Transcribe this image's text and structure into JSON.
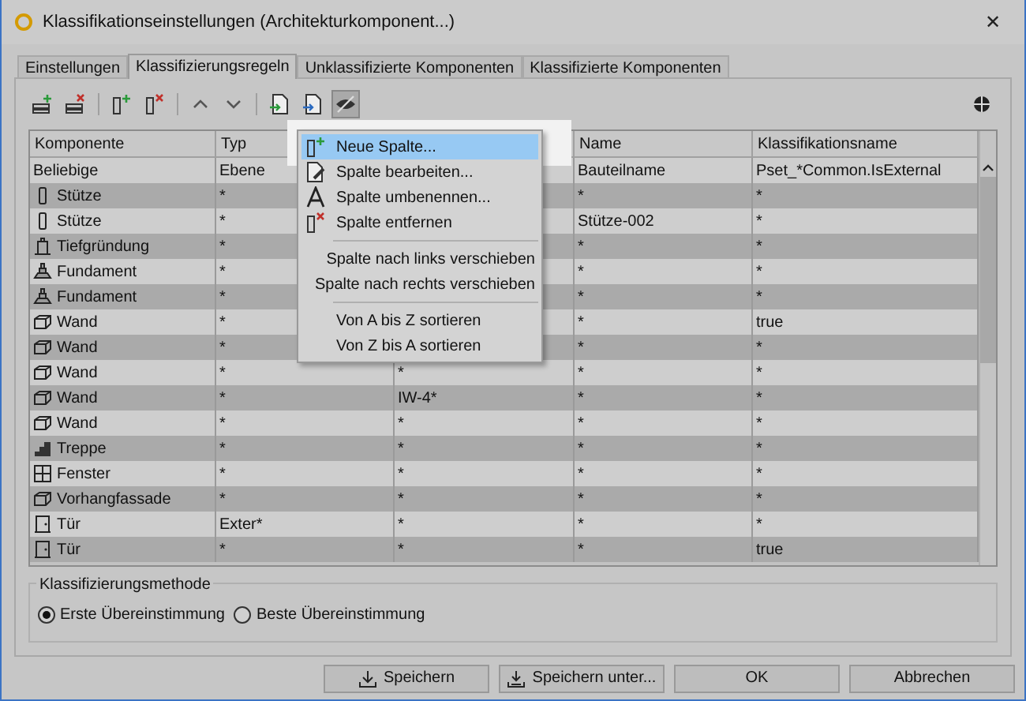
{
  "window": {
    "title": "Klassifikationseinstellungen (Architekturkomponent...)",
    "close": "✕"
  },
  "tabs": [
    {
      "label": "Einstellungen",
      "selected": false
    },
    {
      "label": "Klassifizierungsregeln",
      "selected": true
    },
    {
      "label": "Unklassifizierte Komponenten",
      "selected": false
    },
    {
      "label": "Klassifizierte Komponenten",
      "selected": false
    }
  ],
  "toolbar": [
    {
      "kind": "add-row"
    },
    {
      "kind": "remove-row"
    },
    {
      "kind": "sep"
    },
    {
      "kind": "add-column"
    },
    {
      "kind": "remove-column"
    },
    {
      "kind": "sep"
    },
    {
      "kind": "up"
    },
    {
      "kind": "down"
    },
    {
      "kind": "sep"
    },
    {
      "kind": "import"
    },
    {
      "kind": "export"
    },
    {
      "kind": "hide",
      "pressed": true
    }
  ],
  "table": {
    "columns": [
      {
        "label": "Komponente"
      },
      {
        "label": "Typ"
      },
      {},
      {
        "label": "Name"
      },
      {
        "label": "Klassifikationsname"
      }
    ],
    "rows": [
      {
        "cells": [
          "Beliebige",
          "Ebene",
          null,
          "Bauteilname",
          "Pset_*Common.IsExternal"
        ]
      },
      {
        "kind": "column",
        "cells": [
          "Stütze",
          "*",
          null,
          "*",
          "*"
        ]
      },
      {
        "kind": "column",
        "cells": [
          "Stütze",
          "*",
          null,
          "Stütze-002",
          "*"
        ]
      },
      {
        "kind": "pile",
        "cells": [
          "Tiefgründung",
          "*",
          null,
          "*",
          "*"
        ]
      },
      {
        "kind": "footing",
        "cells": [
          "Fundament",
          "*",
          null,
          "*",
          "*"
        ]
      },
      {
        "kind": "footing",
        "cells": [
          "Fundament",
          "*",
          null,
          "*",
          "*"
        ]
      },
      {
        "kind": "wall",
        "cells": [
          "Wand",
          "*",
          null,
          "*",
          "true"
        ]
      },
      {
        "kind": "wall",
        "cells": [
          "Wand",
          "*",
          null,
          "*",
          "*"
        ]
      },
      {
        "kind": "wall",
        "cells": [
          "Wand",
          "*",
          "*",
          "*",
          "*"
        ]
      },
      {
        "kind": "wall",
        "cells": [
          "Wand",
          "*",
          "IW-4*",
          "*",
          "*"
        ]
      },
      {
        "kind": "wall",
        "cells": [
          "Wand",
          "*",
          "*",
          "*",
          "*"
        ]
      },
      {
        "kind": "stair",
        "cells": [
          "Treppe",
          "*",
          "*",
          "*",
          "*"
        ]
      },
      {
        "kind": "window",
        "cells": [
          "Fenster",
          "*",
          "*",
          "*",
          "*"
        ]
      },
      {
        "kind": "wall",
        "cells": [
          "Vorhangfassade",
          "*",
          "*",
          "*",
          "*"
        ]
      },
      {
        "kind": "door",
        "cells": [
          "Tür",
          "Exter*",
          "*",
          "*",
          "*"
        ]
      },
      {
        "kind": "door",
        "cells": [
          "Tür",
          "*",
          "*",
          "*",
          "true"
        ]
      }
    ]
  },
  "context_menu": [
    {
      "kind": "add-column",
      "label": "Neue Spalte...",
      "selected": true
    },
    {
      "kind": "edit",
      "label": "Spalte bearbeiten...",
      "selected": false
    },
    {
      "kind": "rename",
      "label": "Spalte umbenennen...",
      "selected": false
    },
    {
      "kind": "remove-column",
      "label": "Spalte entfernen",
      "selected": false
    },
    {
      "kind": "separator"
    },
    {
      "kind": "plain",
      "label": "Spalte nach links verschieben",
      "selected": false
    },
    {
      "kind": "plain",
      "label": "Spalte nach rechts verschieben",
      "selected": false
    },
    {
      "kind": "separator"
    },
    {
      "kind": "plain",
      "label": "Von A bis Z sortieren",
      "selected": false
    },
    {
      "kind": "plain",
      "label": "Von Z bis A sortieren",
      "selected": false
    }
  ],
  "method": {
    "title": "Klassifizierungsmethode",
    "options": [
      {
        "label": "Erste Übereinstimmung",
        "selected": true
      },
      {
        "label": "Beste Übereinstimmung",
        "selected": false
      }
    ]
  },
  "buttons": [
    {
      "label": "Speichern",
      "kind": "download"
    },
    {
      "label": "Speichern unter...",
      "kind": "download-many"
    },
    {
      "label": "OK",
      "kind": "plain"
    },
    {
      "label": "Abbrechen",
      "kind": "plain"
    }
  ]
}
